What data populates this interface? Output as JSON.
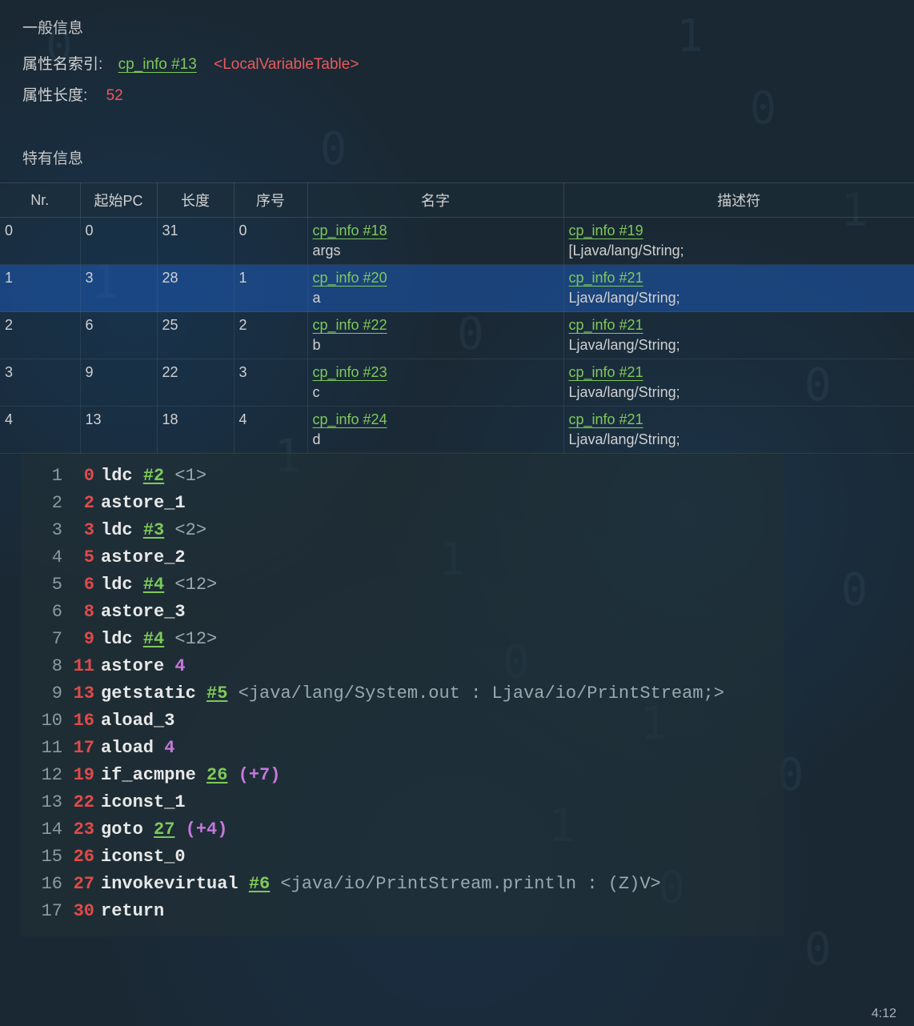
{
  "general": {
    "title": "一般信息",
    "attr_name_index_label": "属性名索引:",
    "attr_name_index_link": "cp_info #13",
    "attr_name_tag": "<LocalVariableTable>",
    "attr_length_label": "属性长度:",
    "attr_length_value": "52"
  },
  "specific": {
    "title": "特有信息",
    "headers": {
      "nr": "Nr.",
      "start_pc": "起始PC",
      "length": "长度",
      "index": "序号",
      "name": "名字",
      "descriptor": "描述符"
    },
    "rows": [
      {
        "nr": "0",
        "start_pc": "0",
        "length": "31",
        "index": "0",
        "name_link": "cp_info #18",
        "name_val": "args",
        "desc_link": "cp_info #19",
        "desc_val": "[Ljava/lang/String;",
        "selected": false
      },
      {
        "nr": "1",
        "start_pc": "3",
        "length": "28",
        "index": "1",
        "name_link": "cp_info #20",
        "name_val": "a",
        "desc_link": "cp_info #21",
        "desc_val": "Ljava/lang/String;",
        "selected": true
      },
      {
        "nr": "2",
        "start_pc": "6",
        "length": "25",
        "index": "2",
        "name_link": "cp_info #22",
        "name_val": "b",
        "desc_link": "cp_info #21",
        "desc_val": "Ljava/lang/String;",
        "selected": false
      },
      {
        "nr": "3",
        "start_pc": "9",
        "length": "22",
        "index": "3",
        "name_link": "cp_info #23",
        "name_val": "c",
        "desc_link": "cp_info #21",
        "desc_val": "Ljava/lang/String;",
        "selected": false
      },
      {
        "nr": "4",
        "start_pc": "13",
        "length": "18",
        "index": "4",
        "name_link": "cp_info #24",
        "name_val": "d",
        "desc_link": "cp_info #21",
        "desc_val": "Ljava/lang/String;",
        "selected": false
      }
    ]
  },
  "bytecode": [
    {
      "ln": "1",
      "pc": "0",
      "parts": [
        {
          "t": "op",
          "v": "ldc"
        },
        {
          "t": "sp"
        },
        {
          "t": "green",
          "v": "#2"
        },
        {
          "t": "sp"
        },
        {
          "t": "gray",
          "v": "<1>"
        }
      ]
    },
    {
      "ln": "2",
      "pc": "2",
      "parts": [
        {
          "t": "op",
          "v": "astore_1"
        }
      ]
    },
    {
      "ln": "3",
      "pc": "3",
      "parts": [
        {
          "t": "op",
          "v": "ldc"
        },
        {
          "t": "sp"
        },
        {
          "t": "green",
          "v": "#3"
        },
        {
          "t": "sp"
        },
        {
          "t": "gray",
          "v": "<2>"
        }
      ]
    },
    {
      "ln": "4",
      "pc": "5",
      "parts": [
        {
          "t": "op",
          "v": "astore_2"
        }
      ]
    },
    {
      "ln": "5",
      "pc": "6",
      "parts": [
        {
          "t": "op",
          "v": "ldc"
        },
        {
          "t": "sp"
        },
        {
          "t": "green",
          "v": "#4"
        },
        {
          "t": "sp"
        },
        {
          "t": "gray",
          "v": "<12>"
        }
      ]
    },
    {
      "ln": "6",
      "pc": "8",
      "parts": [
        {
          "t": "op",
          "v": "astore_3"
        }
      ]
    },
    {
      "ln": "7",
      "pc": "9",
      "parts": [
        {
          "t": "op",
          "v": "ldc"
        },
        {
          "t": "sp"
        },
        {
          "t": "green",
          "v": "#4"
        },
        {
          "t": "sp"
        },
        {
          "t": "gray",
          "v": "<12>"
        }
      ]
    },
    {
      "ln": "8",
      "pc": "11",
      "parts": [
        {
          "t": "op",
          "v": "astore"
        },
        {
          "t": "sp"
        },
        {
          "t": "purple",
          "v": "4"
        }
      ]
    },
    {
      "ln": "9",
      "pc": "13",
      "parts": [
        {
          "t": "op",
          "v": "getstatic"
        },
        {
          "t": "sp"
        },
        {
          "t": "green",
          "v": "#5"
        },
        {
          "t": "sp"
        },
        {
          "t": "gray",
          "v": "<java/lang/System.out : Ljava/io/PrintStream;>"
        }
      ]
    },
    {
      "ln": "10",
      "pc": "16",
      "parts": [
        {
          "t": "op",
          "v": "aload_3"
        }
      ]
    },
    {
      "ln": "11",
      "pc": "17",
      "parts": [
        {
          "t": "op",
          "v": "aload"
        },
        {
          "t": "sp"
        },
        {
          "t": "purple",
          "v": "4"
        }
      ]
    },
    {
      "ln": "12",
      "pc": "19",
      "parts": [
        {
          "t": "op",
          "v": "if_acmpne"
        },
        {
          "t": "sp"
        },
        {
          "t": "green",
          "v": "26"
        },
        {
          "t": "sp"
        },
        {
          "t": "purple",
          "v": "(+7)"
        }
      ]
    },
    {
      "ln": "13",
      "pc": "22",
      "parts": [
        {
          "t": "op",
          "v": "iconst_1"
        }
      ]
    },
    {
      "ln": "14",
      "pc": "23",
      "parts": [
        {
          "t": "op",
          "v": "goto"
        },
        {
          "t": "sp"
        },
        {
          "t": "green",
          "v": "27"
        },
        {
          "t": "sp"
        },
        {
          "t": "purple",
          "v": "(+4)"
        }
      ]
    },
    {
      "ln": "15",
      "pc": "26",
      "parts": [
        {
          "t": "op",
          "v": "iconst_0"
        }
      ]
    },
    {
      "ln": "16",
      "pc": "27",
      "parts": [
        {
          "t": "op",
          "v": "invokevirtual"
        },
        {
          "t": "sp"
        },
        {
          "t": "green",
          "v": "#6"
        },
        {
          "t": "sp"
        },
        {
          "t": "gray",
          "v": "<java/io/PrintStream.println : (Z)V>"
        }
      ]
    },
    {
      "ln": "17",
      "pc": "30",
      "parts": [
        {
          "t": "op",
          "v": "return"
        }
      ]
    }
  ],
  "status": {
    "pos": "4:12"
  }
}
